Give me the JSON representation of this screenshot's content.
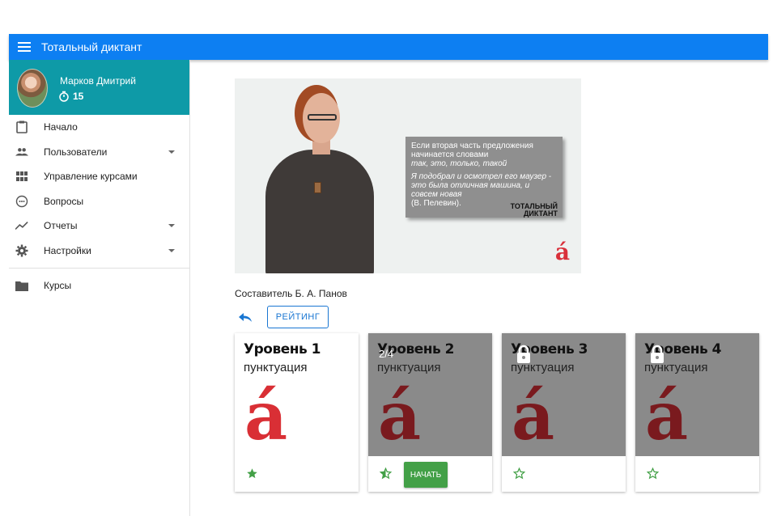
{
  "app": {
    "title": "Тотальный диктант",
    "accent": "#0d7ff2"
  },
  "user": {
    "name": "Марков Дмитрий",
    "points": "15"
  },
  "sidebar": {
    "items": [
      {
        "label": "Начало",
        "icon": "clipboard-icon"
      },
      {
        "label": "Пользователи",
        "icon": "people-icon",
        "expandable": true
      },
      {
        "label": "Управление курсами",
        "icon": "grid-icon"
      },
      {
        "label": "Вопросы",
        "icon": "question-circle-icon"
      },
      {
        "label": "Отчеты",
        "icon": "trend-icon",
        "expandable": true
      },
      {
        "label": "Настройки",
        "icon": "gear-icon",
        "expandable": true
      }
    ],
    "secondary": [
      {
        "label": "Курсы",
        "icon": "folder-icon"
      }
    ]
  },
  "video": {
    "slide_lines": [
      "Если вторая часть предложения",
      "начинается словами"
    ],
    "slide_keywords": "так, это, только, такой",
    "slide_example": [
      "Я подобрал и осмотрел его маузер -",
      "это была отличная машина, и",
      "совсем новая"
    ],
    "slide_source": "(В. Пелевин).",
    "logo_line1": "ТОТАЛЬНЫЙ",
    "logo_line2": "ДИКТАНТ",
    "brand": "á"
  },
  "author": "Составитель Б. А. Панов",
  "rating_label": "РЕЙТИНГ",
  "levels": [
    {
      "title": "Уровень 1",
      "subtitle": "пунктуация",
      "letter": "á",
      "locked": false,
      "star": "filled"
    },
    {
      "title": "Уровень 2",
      "subtitle": "пунктуация",
      "letter": "á",
      "locked": false,
      "dimmed": true,
      "progress": "2/4",
      "star": "half",
      "action": "НАЧАТЬ"
    },
    {
      "title": "Уровень 3",
      "subtitle": "пунктуация",
      "letter": "á",
      "locked": true,
      "star": "outline"
    },
    {
      "title": "Уровень 4",
      "subtitle": "пунктуация",
      "letter": "á",
      "locked": true,
      "star": "outline"
    }
  ],
  "colors": {
    "sidebar_header": "#0e9aa7",
    "star": "#43a047",
    "start_button": "#43a047",
    "brand_red": "#d92f35"
  }
}
